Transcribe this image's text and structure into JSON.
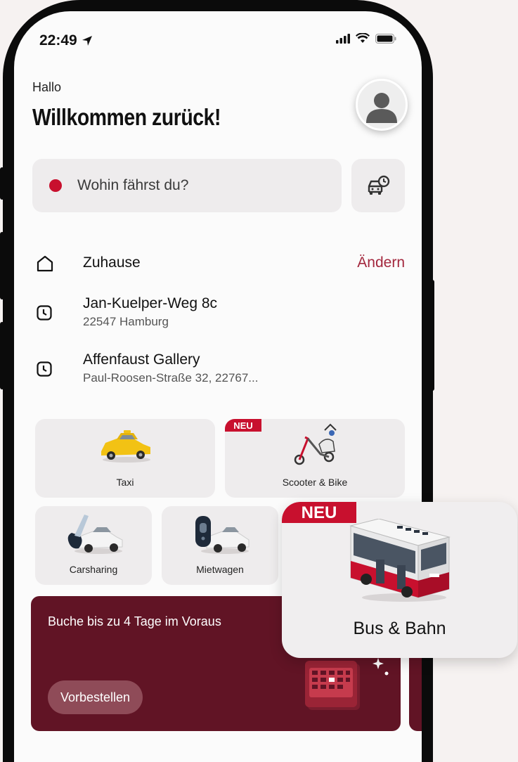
{
  "status_bar": {
    "time": "22:49"
  },
  "header": {
    "greeting": "Hallo",
    "title": "Willkommen zurück!"
  },
  "search": {
    "placeholder": "Wohin fährst du?"
  },
  "places": [
    {
      "title": "Zuhause",
      "action": "Ändern",
      "icon": "home-icon"
    },
    {
      "title": "Jan-Kuelper-Weg 8c",
      "subtitle": "22547 Hamburg",
      "icon": "clock-icon"
    },
    {
      "title": "Affenfaust Gallery",
      "subtitle": "Paul-Roosen-Straße 32, 22767...",
      "icon": "clock-icon"
    }
  ],
  "services": [
    {
      "label": "Taxi"
    },
    {
      "label": "Scooter & Bike",
      "badge": "NEU"
    },
    {
      "label": "Carsharing"
    },
    {
      "label": "Mietwagen"
    }
  ],
  "promo": {
    "text": "Buche bis zu 4 Tage im Voraus",
    "button": "Vorbestellen"
  },
  "popup": {
    "badge": "NEU",
    "label": "Bus & Bahn"
  },
  "colors": {
    "brand_red": "#c8102e",
    "promo_bg": "#611425",
    "accent_text": "#a3273d"
  }
}
